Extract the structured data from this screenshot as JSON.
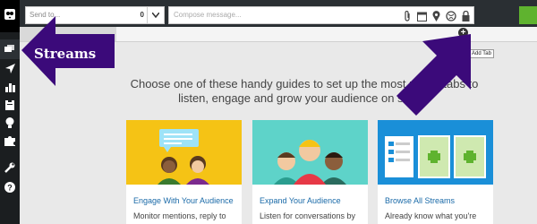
{
  "sidebar": {
    "icons": [
      "owl-logo-icon",
      "streams-icon",
      "send-icon",
      "analytics-icon",
      "assignments-icon",
      "lightbulb-icon",
      "puzzle-icon",
      "wrench-icon",
      "help-icon"
    ]
  },
  "topbar": {
    "send_to_placeholder": "Send to...",
    "send_to_count": "0",
    "compose_placeholder": "Compose message..."
  },
  "tooltip": "Add Tab",
  "guides_text": "Choose one of these handy guides to set up the most useful tabs to listen, engage and grow your audience on social.",
  "annotation": "Streams",
  "cards": [
    {
      "title": "Engage With Your Audience",
      "desc": "Monitor mentions, reply to",
      "color": "#f5c315"
    },
    {
      "title": "Expand Your Audience",
      "desc": "Listen for conversations by",
      "color": "#5ed3c9"
    },
    {
      "title": "Browse All Streams",
      "desc": "Already know what you're",
      "color": "#1a8fd8"
    }
  ],
  "colors": {
    "annotation_arrow": "#3b0a7a",
    "accent_green": "#5fb32f"
  }
}
